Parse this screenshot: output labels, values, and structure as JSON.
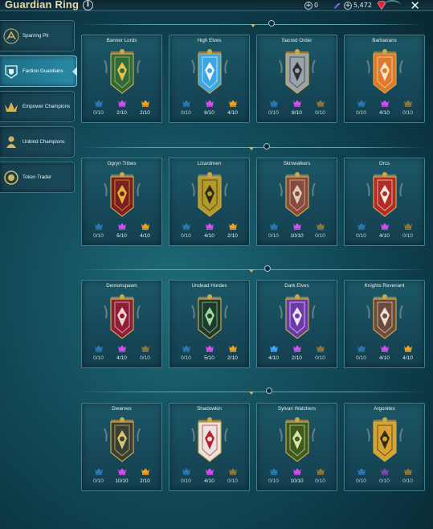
{
  "window": {
    "title": "Guardian Ring"
  },
  "currencies": [
    {
      "name": "gems",
      "value": "0"
    },
    {
      "name": "silver",
      "value": "5,472"
    }
  ],
  "colors": {
    "rare": "#3ea2ff",
    "epic": "#d34df0",
    "legendary": "#f0a21e",
    "accent": "#d6b356"
  },
  "sidebar": {
    "items": [
      {
        "label": "Sparring Pit",
        "icon": "sparring-pit-icon",
        "active": false
      },
      {
        "label": "Faction Guardians",
        "icon": "faction-guardians-icon",
        "active": true
      },
      {
        "label": "Empower Champions",
        "icon": "empower-champions-icon",
        "active": false
      },
      {
        "label": "Unbind Champions",
        "icon": "unbind-champions-icon",
        "active": false
      },
      {
        "label": "Token Trader",
        "icon": "token-trader-icon",
        "active": false
      }
    ]
  },
  "factions": [
    {
      "name": "Banner Lords",
      "colors": [
        "#2e6a3e",
        "#e7c24a"
      ],
      "rare": "0/10",
      "epic": "2/10",
      "legendary": "2/10"
    },
    {
      "name": "High Elves",
      "colors": [
        "#3aa6e4",
        "#f1f4f6"
      ],
      "rare": "0/10",
      "epic": "6/10",
      "legendary": "4/10"
    },
    {
      "name": "Sacred Order",
      "colors": [
        "#9aa4aa",
        "#2b2f33"
      ],
      "rare": "0/10",
      "epic": "8/10",
      "legendary": "0/10"
    },
    {
      "name": "Barbarians",
      "colors": [
        "#e07a28",
        "#f3e4cf"
      ],
      "rare": "0/10",
      "epic": "4/10",
      "legendary": "0/10"
    },
    {
      "name": "Ogryn Tribes",
      "colors": [
        "#7a1e1e",
        "#e4b541"
      ],
      "rare": "0/10",
      "epic": "6/10",
      "legendary": "4/10"
    },
    {
      "name": "Lizardmen",
      "colors": [
        "#b39a2a",
        "#2d2a1a"
      ],
      "rare": "0/10",
      "epic": "4/10",
      "legendary": "2/10"
    },
    {
      "name": "Skinwalkers",
      "colors": [
        "#8a4a3a",
        "#d9cfc0"
      ],
      "rare": "0/10",
      "epic": "10/10",
      "legendary": "0/10"
    },
    {
      "name": "Orcs",
      "colors": [
        "#b52a24",
        "#f0eadf"
      ],
      "rare": "0/10",
      "epic": "4/10",
      "legendary": "0/10"
    },
    {
      "name": "Demonspawn",
      "colors": [
        "#8e1e36",
        "#f0d6d6"
      ],
      "rare": "0/10",
      "epic": "4/10",
      "legendary": "0/10"
    },
    {
      "name": "Undead Hordes",
      "colors": [
        "#1e3a2c",
        "#9ed79e"
      ],
      "rare": "0/10",
      "epic": "5/10",
      "legendary": "2/10"
    },
    {
      "name": "Dark Elves",
      "colors": [
        "#6b3aa8",
        "#efe4f8"
      ],
      "rare": "4/10",
      "epic": "2/10",
      "legendary": "0/10"
    },
    {
      "name": "Knights Revenant",
      "colors": [
        "#6d4a3a",
        "#e6e0d6"
      ],
      "rare": "0/10",
      "epic": "4/10",
      "legendary": "4/10"
    },
    {
      "name": "Dwarves",
      "colors": [
        "#3a3f33",
        "#d5c37a"
      ],
      "rare": "0/10",
      "epic": "10/10",
      "legendary": "2/10"
    },
    {
      "name": "Shadowkin",
      "colors": [
        "#e8e4e0",
        "#b8212a"
      ],
      "rare": "0/10",
      "epic": "4/10",
      "legendary": "0/10"
    },
    {
      "name": "Sylvan Watchers",
      "colors": [
        "#3e5a1e",
        "#d8e4a2"
      ],
      "rare": "0/10",
      "epic": "10/10",
      "legendary": "0/10"
    },
    {
      "name": "Argonites",
      "colors": [
        "#d6a431",
        "#3a2a14"
      ],
      "rare": "0/10",
      "epic": "0/10",
      "legendary": "0/10"
    }
  ]
}
